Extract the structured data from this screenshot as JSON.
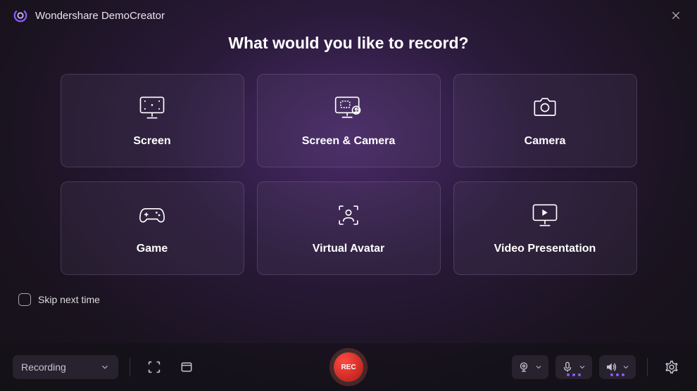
{
  "titlebar": {
    "brand": "Wondershare DemoCreator"
  },
  "heading": "What would you like to record?",
  "cards": [
    {
      "label": "Screen"
    },
    {
      "label": "Screen & Camera"
    },
    {
      "label": "Camera"
    },
    {
      "label": "Game"
    },
    {
      "label": "Virtual Avatar"
    },
    {
      "label": "Video Presentation"
    }
  ],
  "skip": {
    "label": "Skip next time"
  },
  "bottom": {
    "mode": "Recording",
    "rec": "REC"
  }
}
